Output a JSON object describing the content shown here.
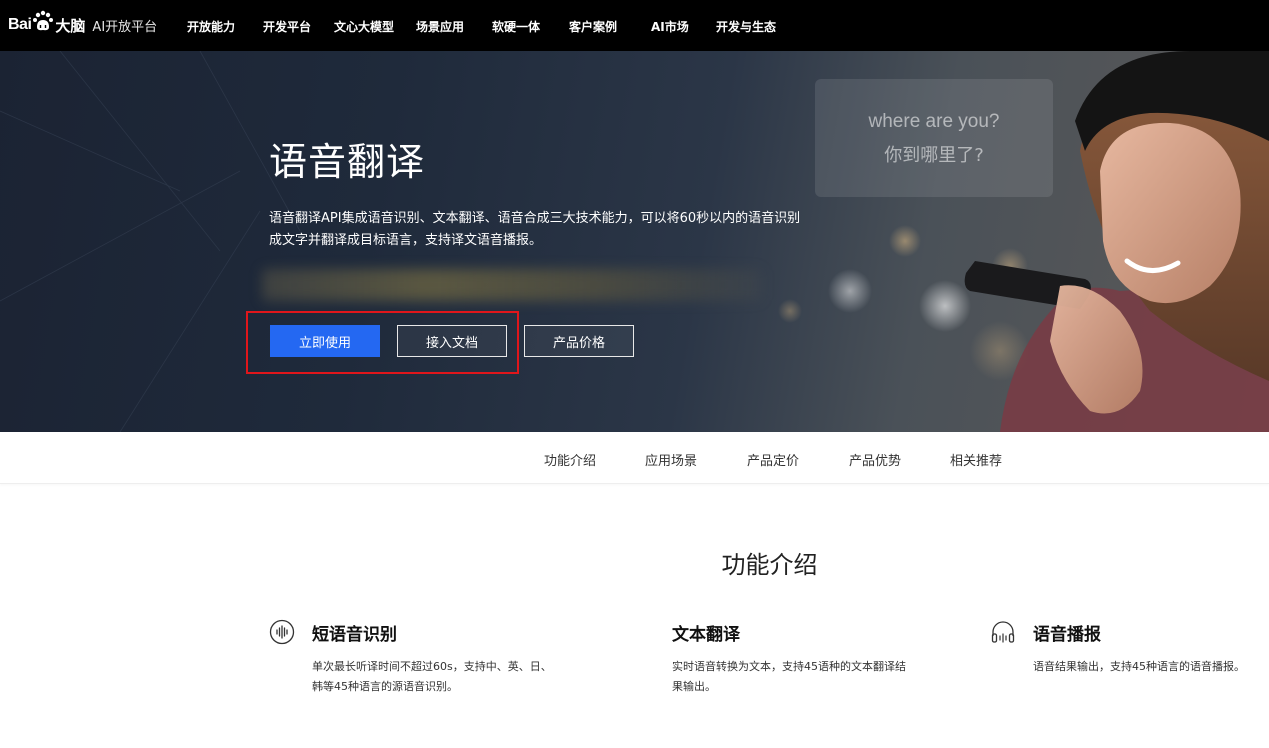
{
  "topnav": {
    "logo": {
      "bai": "Bai",
      "du": "大脑",
      "platform": "AI开放平台"
    },
    "items": [
      "开放能力",
      "开发平台",
      "文心大模型",
      "场景应用",
      "软硬一体",
      "客户案例",
      "AI市场",
      "开发与生态"
    ]
  },
  "hero": {
    "title": "语音翻译",
    "description": "语音翻译API集成语音识别、文本翻译、语音合成三大技术能力，可以将60秒以内的语音识别成文字并翻译成目标语言，支持译文语音播报。",
    "bubble": {
      "english": "where are you?",
      "chinese": "你到哪里了?"
    },
    "buttons": {
      "primary": "立即使用",
      "docs": "接入文档",
      "pricing": "产品价格"
    }
  },
  "subnav": {
    "items": [
      "功能介绍",
      "应用场景",
      "产品定价",
      "产品优势",
      "相关推荐"
    ]
  },
  "features": {
    "section_title": "功能介绍",
    "items": [
      {
        "icon": "sound-wave-icon",
        "title": "短语音识别",
        "description": "单次最长听译时间不超过60s，支持中、英、日、韩等45种语言的源语音识别。"
      },
      {
        "title": "文本翻译",
        "description": "实时语音转换为文本，支持45语种的文本翻译结果输出。"
      },
      {
        "icon": "headphones-icon",
        "title": "语音播报",
        "description": "语音结果输出，支持45种语言的语音播报。"
      }
    ]
  },
  "colors": {
    "nav_bg": "#000000",
    "primary": "#2468f2",
    "highlight": "#e0161b"
  }
}
